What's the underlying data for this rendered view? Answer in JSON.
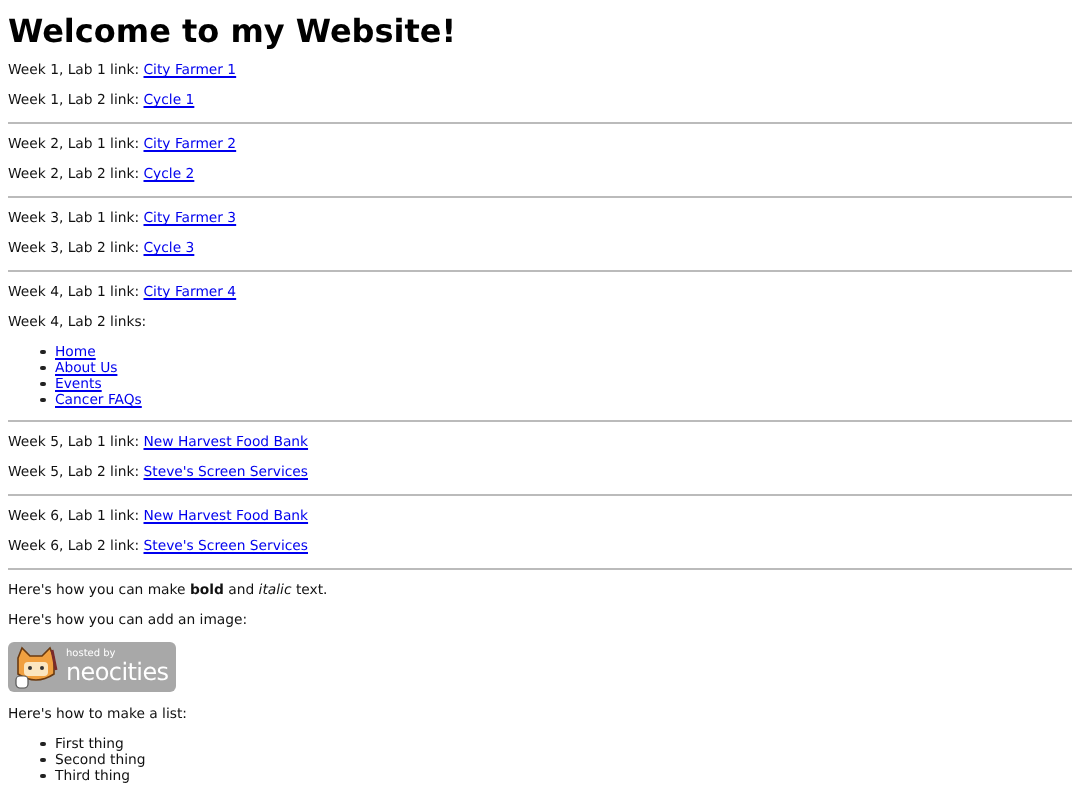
{
  "title": "Welcome to my Website!",
  "weeks": [
    {
      "entries": [
        {
          "kind": "link",
          "label": "Week 1, Lab 1 link:",
          "link": "City Farmer 1"
        },
        {
          "kind": "link",
          "label": "Week 1, Lab 2 link:",
          "link": "Cycle 1"
        }
      ]
    },
    {
      "entries": [
        {
          "kind": "link",
          "label": "Week 2, Lab 1 link:",
          "link": "City Farmer 2"
        },
        {
          "kind": "link",
          "label": "Week 2, Lab 2 link:",
          "link": "Cycle 2"
        }
      ]
    },
    {
      "entries": [
        {
          "kind": "link",
          "label": "Week 3, Lab 1 link:",
          "link": "City Farmer 3"
        },
        {
          "kind": "link",
          "label": "Week 3, Lab 2 link:",
          "link": "Cycle 3"
        }
      ]
    },
    {
      "entries": [
        {
          "kind": "link",
          "label": "Week 4, Lab 1 link:",
          "link": "City Farmer 4"
        },
        {
          "kind": "list",
          "label": "Week 4, Lab 2 links:",
          "links": [
            "Home",
            "About Us",
            "Events",
            "Cancer FAQs"
          ]
        }
      ]
    },
    {
      "entries": [
        {
          "kind": "link",
          "label": "Week 5, Lab 1 link:",
          "link": "New Harvest Food Bank"
        },
        {
          "kind": "link",
          "label": "Week 5, Lab 2 link:",
          "link": "Steve's Screen Services"
        }
      ]
    },
    {
      "entries": [
        {
          "kind": "link",
          "label": "Week 6, Lab 1 link:",
          "link": "New Harvest Food Bank"
        },
        {
          "kind": "link",
          "label": "Week 6, Lab 2 link:",
          "link": "Steve's Screen Services"
        }
      ]
    }
  ],
  "format_text": "Here's how you can make **bold** and *italic* text.",
  "image_text": "Here's how you can add an image:",
  "badge": {
    "caption": "hosted by",
    "name": "neocities"
  },
  "list_text": "Here's how to make a list:",
  "list": [
    "First thing",
    "Second thing",
    "Third thing"
  ]
}
